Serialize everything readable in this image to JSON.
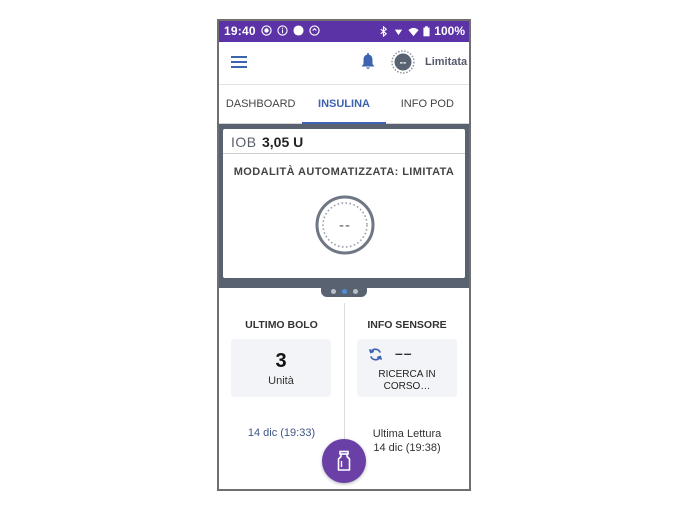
{
  "status_bar": {
    "time": "19:40",
    "battery_text": "100%"
  },
  "header": {
    "mode_label": "Limitata",
    "mode_icon_text": "--"
  },
  "tabs": [
    {
      "label": "DASHBOARD",
      "active": false
    },
    {
      "label": "INSULINA",
      "active": true
    },
    {
      "label": "INFO POD",
      "active": false
    }
  ],
  "iob": {
    "label": "IOB",
    "value": "3,05 U"
  },
  "automated_mode": {
    "text": "MODALITÀ AUTOMATIZZATA: LIMITATA",
    "gauge_text": "--"
  },
  "pager": {
    "count": 3,
    "active_index": 1
  },
  "last_bolus": {
    "title": "ULTIMO BOLO",
    "value": "3",
    "unit": "Unità",
    "date": "14 dic (19:33)"
  },
  "sensor_info": {
    "title": "INFO SENSORE",
    "value": "––",
    "status_line1": "RICERCA IN",
    "status_line2": "CORSO…",
    "last_reading_label": "Ultima Lettura",
    "last_reading_date": "14 dic (19:38)"
  },
  "colors": {
    "status_bar": "#5b33a6",
    "accent_blue": "#3e64b0",
    "carousel_bg": "#596271",
    "fab": "#6a3fa6"
  },
  "icons": {
    "menu": "hamburger-menu-icon",
    "notifications": "bell-icon",
    "bolus_fab": "insulin-vial-icon",
    "sensor_sync": "sync-icon"
  }
}
